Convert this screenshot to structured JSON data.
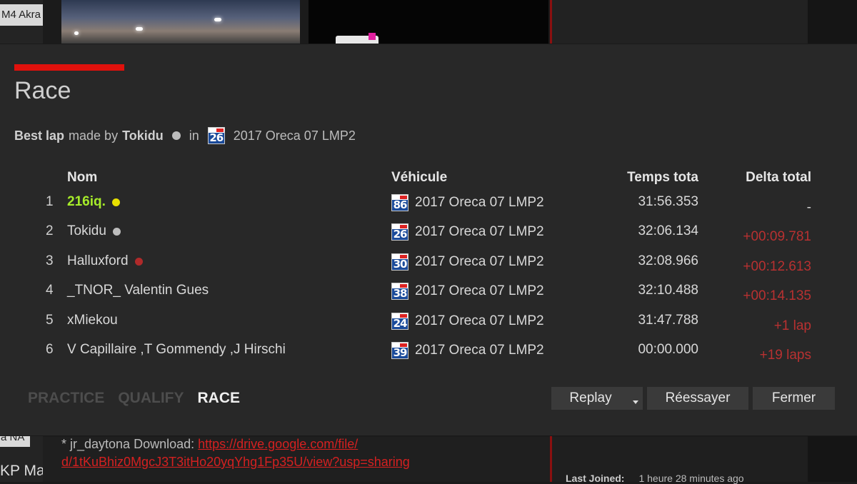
{
  "background": {
    "left_top_label": "M4 Akra",
    "left_mid_label": "a NA",
    "left_bottom_label": "KP Ma",
    "download_prefix": "* jr_daytona Download: ",
    "download_link_line1": "https://drive.google.com/file/",
    "download_link_line2": "d/1tKuBhiz0MgcJ3T3itHo20yqYhg1Fp35U/view?usp=sharing",
    "last_joined_label": "Last Joined:",
    "last_joined_value": "1 heure 28 minutes ago"
  },
  "dialog": {
    "title": "Race",
    "accent_color": "#e0110c",
    "best_lap": {
      "label": "Best lap",
      "made_by": "made by",
      "driver": "Tokidu",
      "driver_dot_color": "#bdbdbd",
      "in": "in",
      "car_number": "26",
      "car": "2017 Oreca 07 LMP2"
    },
    "columns": {
      "name": "Nom",
      "vehicle": "Véhicule",
      "total_time": "Temps tota",
      "delta": "Delta total"
    },
    "results": [
      {
        "pos": "1",
        "name": "216iq.",
        "highlight": true,
        "dot_color": "#e8e000",
        "car_number": "86",
        "car": "2017 Oreca 07 LMP2",
        "time": "31:56.353",
        "delta": "-"
      },
      {
        "pos": "2",
        "name": "Tokidu",
        "highlight": false,
        "dot_color": "#bdbdbd",
        "car_number": "26",
        "car": "2017 Oreca 07 LMP2",
        "time": "32:06.134",
        "delta": "+00:09.781"
      },
      {
        "pos": "3",
        "name": "Halluxford",
        "highlight": false,
        "dot_color": "#b02a2a",
        "car_number": "30",
        "car": "2017 Oreca 07 LMP2",
        "time": "32:08.966",
        "delta": "+00:12.613"
      },
      {
        "pos": "4",
        "name": "_TNOR_ Valentin Gues",
        "highlight": false,
        "dot_color": "",
        "car_number": "38",
        "car": "2017 Oreca 07 LMP2",
        "time": "32:10.488",
        "delta": "+00:14.135"
      },
      {
        "pos": "5",
        "name": "xMiekou",
        "highlight": false,
        "dot_color": "",
        "car_number": "24",
        "car": "2017 Oreca 07 LMP2",
        "time": "31:47.788",
        "delta": "+1 lap"
      },
      {
        "pos": "6",
        "name": "V Capillaire ,T Gommendy ,J Hirschi",
        "highlight": false,
        "dot_color": "",
        "car_number": "39",
        "car": "2017 Oreca 07 LMP2",
        "time": "00:00.000",
        "delta": "+19 laps"
      }
    ],
    "tabs": [
      "PRACTICE",
      "QUALIFY",
      "RACE"
    ],
    "active_tab": "RACE",
    "buttons": {
      "replay": "Replay",
      "retry": "Réessayer",
      "close": "Fermer"
    },
    "colors": {
      "highlight_name": "#a6ec2a",
      "delta": "#b83131"
    }
  }
}
